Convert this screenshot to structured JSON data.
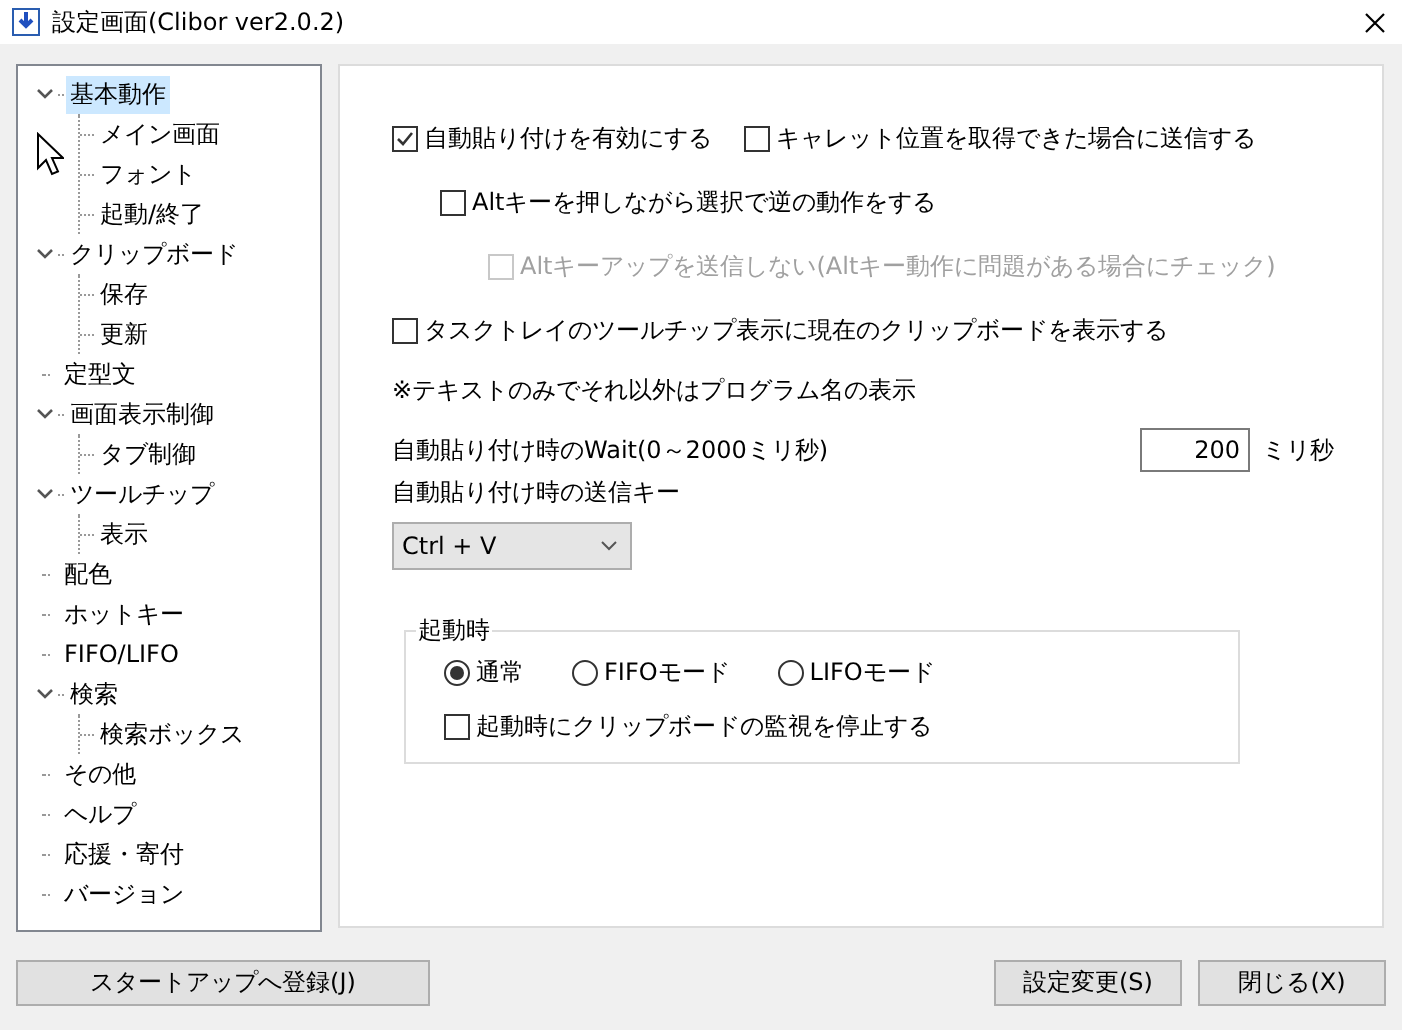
{
  "window": {
    "title": "設定画面(Clibor ver2.0.2)"
  },
  "tree": [
    {
      "label": "基本動作",
      "selected": true,
      "expanded": true,
      "children": [
        {
          "label": "メイン画面",
          "selected": false
        },
        {
          "label": "フォント",
          "selected": false
        },
        {
          "label": "起動/終了",
          "selected": false
        }
      ]
    },
    {
      "label": "クリップボード",
      "selected": false,
      "expanded": true,
      "children": [
        {
          "label": "保存",
          "selected": false
        },
        {
          "label": "更新",
          "selected": false
        }
      ]
    },
    {
      "label": "定型文",
      "selected": false
    },
    {
      "label": "画面表示制御",
      "selected": false,
      "expanded": true,
      "children": [
        {
          "label": "タブ制御",
          "selected": false
        }
      ]
    },
    {
      "label": "ツールチップ",
      "selected": false,
      "expanded": true,
      "children": [
        {
          "label": "表示",
          "selected": false
        }
      ]
    },
    {
      "label": "配色",
      "selected": false
    },
    {
      "label": "ホットキー",
      "selected": false
    },
    {
      "label": "FIFO/LIFO",
      "selected": false
    },
    {
      "label": "検索",
      "selected": false,
      "expanded": true,
      "children": [
        {
          "label": "検索ボックス",
          "selected": false
        }
      ]
    },
    {
      "label": "その他",
      "selected": false
    },
    {
      "label": "ヘルプ",
      "selected": false
    },
    {
      "label": "応援・寄付",
      "selected": false
    },
    {
      "label": "バージョン",
      "selected": false
    }
  ],
  "auto_paste": {
    "label": "自動貼り付けを有効にする",
    "checked": true
  },
  "caret_send": {
    "label": "キャレット位置を取得できた場合に送信する",
    "checked": false
  },
  "alt_reverse": {
    "label": "Altキーを押しながら選択で逆の動作をする",
    "checked": false
  },
  "alt_up": {
    "label": "Altキーアップを送信しない(Altキー動作に問題がある場合にチェック)",
    "checked": false,
    "disabled": true
  },
  "tray_tooltip": {
    "label": "タスクトレイのツールチップ表示に現在のクリップボードを表示する",
    "checked": false
  },
  "note": "※テキストのみでそれ以外はプログラム名の表示",
  "wait": {
    "label": "自動貼り付け時のWait(0～2000ミリ秒)",
    "value": "200",
    "unit": "ミリ秒"
  },
  "send_key": {
    "label": "自動貼り付け時の送信キー",
    "value": "Ctrl + V"
  },
  "startup": {
    "title": "起動時",
    "modes": [
      {
        "label": "通常",
        "selected": true
      },
      {
        "label": "FIFOモード",
        "selected": false
      },
      {
        "label": "LIFOモード",
        "selected": false
      }
    ],
    "stop_monitor": {
      "label": "起動時にクリップボードの監視を停止する",
      "checked": false
    }
  },
  "footer": {
    "left": "スタートアップへ登録(J)",
    "right": [
      "設定変更(S)",
      "閉じる(X)"
    ]
  }
}
